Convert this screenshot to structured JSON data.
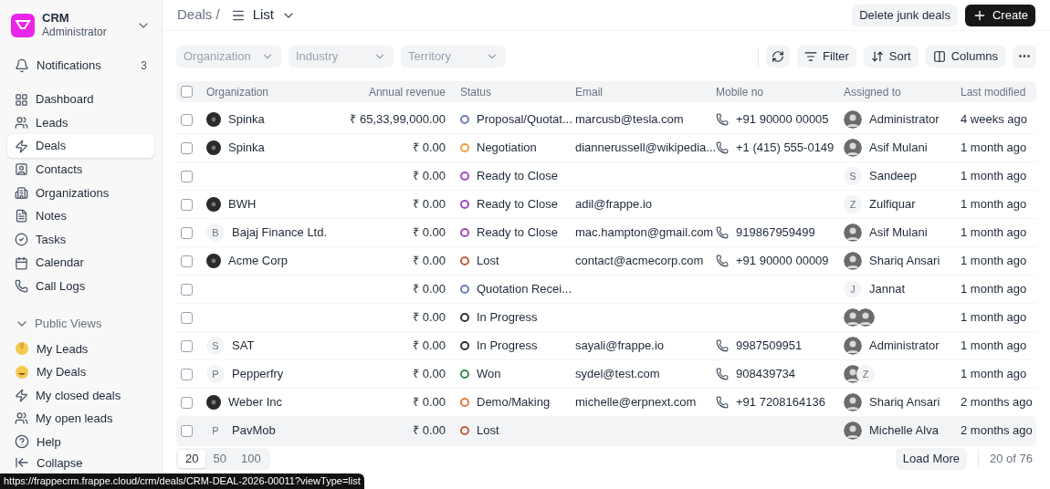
{
  "app": {
    "name": "CRM",
    "user": "Administrator"
  },
  "sidebar": {
    "notifications": {
      "label": "Notifications",
      "count": "3"
    },
    "items": [
      {
        "label": "Dashboard",
        "selected": false
      },
      {
        "label": "Leads",
        "selected": false
      },
      {
        "label": "Deals",
        "selected": true
      },
      {
        "label": "Contacts",
        "selected": false
      },
      {
        "label": "Organizations",
        "selected": false
      },
      {
        "label": "Notes",
        "selected": false
      },
      {
        "label": "Tasks",
        "selected": false
      },
      {
        "label": "Calendar",
        "selected": false
      },
      {
        "label": "Call Logs",
        "selected": false
      }
    ],
    "public_views": {
      "label": "Public Views",
      "expanded": true,
      "items": [
        {
          "label": "My Leads"
        },
        {
          "label": "My Deals"
        },
        {
          "label": "My closed deals"
        },
        {
          "label": "My open leads"
        }
      ]
    },
    "help": "Help",
    "collapse": "Collapse"
  },
  "breadcrumb": {
    "parent": "Deals /",
    "view": "List"
  },
  "actions": [
    "Delete junk deals",
    "Create"
  ],
  "filters": [
    {
      "placeholder": "Organization"
    },
    {
      "placeholder": "Industry"
    },
    {
      "placeholder": "Territory"
    }
  ],
  "toolbar": [
    "Filter",
    "Sort",
    "Columns"
  ],
  "table": {
    "all_selected": false,
    "columns": [
      "Organization",
      "Annual revenue",
      "Status",
      "Email",
      "Mobile no",
      "Assigned to",
      "Last modified"
    ],
    "rows": [
      {
        "org": "Spinka",
        "org_avatar": {
          "kind": "image"
        },
        "revenue": "₹ 65,33,99,000.00",
        "status": "Proposal/Quotat...",
        "color": "#6b7fb8",
        "email": "marcusb@tesla.com",
        "mobile": "+91 90000 00005",
        "assignees": [
          {
            "kind": "image"
          }
        ],
        "assigned": "Administrator",
        "modified": "4 weeks ago",
        "hover": false,
        "selected": false
      },
      {
        "org": "Spinka",
        "org_avatar": {
          "kind": "image"
        },
        "revenue": "₹ 0.00",
        "status": "Negotiation",
        "color": "#e8a23a",
        "email": "diannerussell@wikipedia...",
        "mobile": "+1 (415) 555-0149",
        "assignees": [
          {
            "kind": "image"
          }
        ],
        "assigned": "Asif Mulani",
        "modified": "1 month ago",
        "hover": false,
        "selected": false
      },
      {
        "revenue": "₹ 0.00",
        "status": "Ready to Close",
        "color": "#a04bbf",
        "assignees": [
          {
            "kind": "letter",
            "letter": "S"
          }
        ],
        "assigned": "Sandeep",
        "modified": "1 month ago",
        "hover": false,
        "selected": false
      },
      {
        "org": "BWH",
        "org_avatar": {
          "kind": "image"
        },
        "revenue": "₹ 0.00",
        "status": "Ready to Close",
        "color": "#a04bbf",
        "email": "adil@frappe.io",
        "assignees": [
          {
            "kind": "letter",
            "letter": "Z"
          }
        ],
        "assigned": "Zulfiquar",
        "modified": "1 month ago",
        "hover": false,
        "selected": false
      },
      {
        "org": "Bajaj Finance Ltd.",
        "org_avatar": {
          "kind": "letter",
          "letter": "B"
        },
        "revenue": "₹ 0.00",
        "status": "Ready to Close",
        "color": "#a04bbf",
        "email": "mac.hampton@gmail.com",
        "mobile": "919867959499",
        "assignees": [
          {
            "kind": "image"
          }
        ],
        "assigned": "Asif Mulani",
        "modified": "1 month ago",
        "hover": false,
        "selected": false
      },
      {
        "org": "Acme Corp",
        "org_avatar": {
          "kind": "image"
        },
        "revenue": "₹ 0.00",
        "status": "Lost",
        "color": "#c0603e",
        "email": "contact@acmecorp.com",
        "mobile": "+91 90000 00009",
        "assignees": [
          {
            "kind": "image"
          }
        ],
        "assigned": "Shariq Ansari",
        "modified": "1 month ago",
        "hover": false,
        "selected": false
      },
      {
        "revenue": "₹ 0.00",
        "status": "Quotation Recei...",
        "color": "#6b7fb8",
        "assignees": [
          {
            "kind": "letter",
            "letter": "J"
          }
        ],
        "assigned": "Jannat",
        "modified": "1 month ago",
        "hover": false,
        "selected": false
      },
      {
        "revenue": "₹ 0.00",
        "status": "In Progress",
        "color": "#333333",
        "assignees": [
          {
            "kind": "image"
          },
          {
            "kind": "image"
          }
        ],
        "modified": "1 month ago",
        "hover": false,
        "selected": false
      },
      {
        "org": "SAT",
        "org_avatar": {
          "kind": "letter",
          "letter": "S"
        },
        "revenue": "₹ 0.00",
        "status": "In Progress",
        "color": "#333333",
        "email": "sayali@frappe.io",
        "mobile": "9987509951",
        "assignees": [
          {
            "kind": "image"
          }
        ],
        "assigned": "Administrator",
        "modified": "1 month ago",
        "hover": false,
        "selected": false
      },
      {
        "org": "Pepperfry",
        "org_avatar": {
          "kind": "letter",
          "letter": "P"
        },
        "revenue": "₹ 0.00",
        "status": "Won",
        "color": "#3a8a4e",
        "email": "sydel@test.com",
        "mobile": "908439734",
        "assignees": [
          {
            "kind": "image"
          },
          {
            "kind": "letter",
            "letter": "Z"
          }
        ],
        "modified": "1 month ago",
        "hover": false,
        "selected": false
      },
      {
        "org": "Weber Inc",
        "org_avatar": {
          "kind": "image"
        },
        "revenue": "₹ 0.00",
        "status": "Demo/Making",
        "color": "#e07b3a",
        "email": "michelle@erpnext.com",
        "mobile": "+91 7208164136",
        "assignees": [
          {
            "kind": "image"
          }
        ],
        "assigned": "Shariq Ansari",
        "modified": "2 months ago",
        "hover": false,
        "selected": false
      },
      {
        "org": "PavMob",
        "org_avatar": {
          "kind": "letter",
          "letter": "P"
        },
        "revenue": "₹ 0.00",
        "status": "Lost",
        "color": "#c0603e",
        "assignees": [
          {
            "kind": "image"
          }
        ],
        "assigned": "Michelle Alva",
        "modified": "2 months ago",
        "hover": true,
        "selected": false
      }
    ]
  },
  "footer": {
    "page_sizes": [
      {
        "label": "20",
        "selected": true
      },
      {
        "label": "50",
        "selected": false
      },
      {
        "label": "100",
        "selected": false
      }
    ],
    "load_more": "Load More",
    "count": "20 of 76"
  },
  "status_url": "https://frappecrm.frappe.cloud/crm/deals/CRM-DEAL-2026-00011?viewType=list"
}
